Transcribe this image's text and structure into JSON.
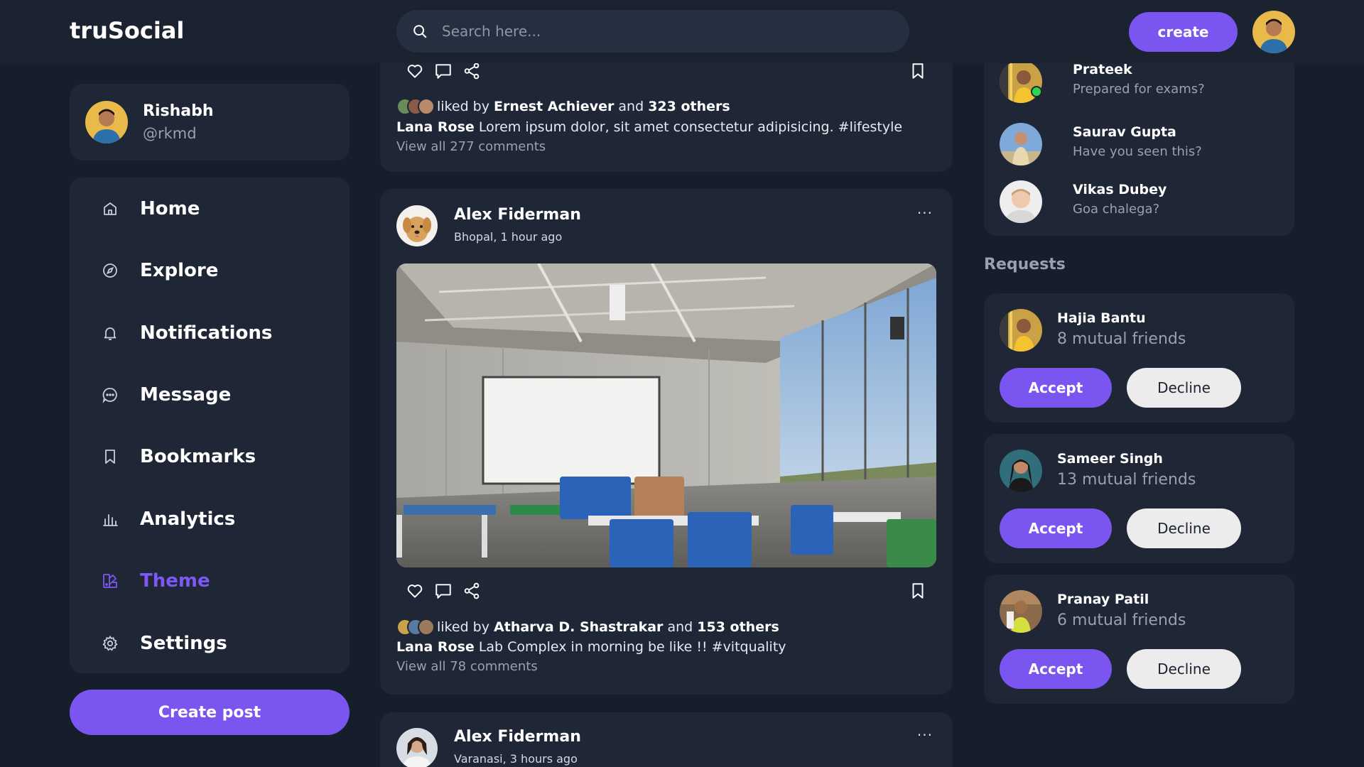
{
  "header": {
    "logo": "truSocial",
    "search_placeholder": "Search here...",
    "create_label": "create"
  },
  "profile": {
    "name": "Rishabh",
    "handle": "@rkmd"
  },
  "nav": {
    "items": [
      {
        "label": "Home",
        "icon": "home-icon"
      },
      {
        "label": "Explore",
        "icon": "compass-icon"
      },
      {
        "label": "Notifications",
        "icon": "bell-icon"
      },
      {
        "label": "Message",
        "icon": "chat-icon"
      },
      {
        "label": "Bookmarks",
        "icon": "bookmark-icon"
      },
      {
        "label": "Analytics",
        "icon": "bar-chart-icon"
      },
      {
        "label": "Theme",
        "icon": "palette-icon",
        "active": true
      },
      {
        "label": "Settings",
        "icon": "gear-icon"
      }
    ],
    "create_post_label": "Create post"
  },
  "feed": {
    "post1": {
      "liked_prefix": "liked by",
      "liked_by": "Ernest Achiever",
      "liked_and": "and",
      "liked_others": "323 others",
      "caption_user": "Lana Rose",
      "caption_text": "Lorem ipsum dolor, sit amet consectetur adipisicing. #lifestyle",
      "comments": "View all 277 comments"
    },
    "post2": {
      "author": "Alex Fiderman",
      "location_time": "Bhopal, 1 hour ago",
      "liked_prefix": "liked by",
      "liked_by": "Atharva D. Shastrakar",
      "liked_and": "and",
      "liked_others": "153 others",
      "caption_user": "Lana Rose",
      "caption_text": "Lab Complex in morning be like !! #vitquality",
      "comments": "View all 78 comments"
    },
    "post3": {
      "author": "Alex Fiderman",
      "location_time": "Varanasi, 3 hours ago"
    },
    "more_label": "···"
  },
  "messages": [
    {
      "name": "Prateek",
      "text": "Prepared for exams?",
      "online": true
    },
    {
      "name": "Saurav Gupta",
      "text": "Have you seen this?"
    },
    {
      "name": "Vikas Dubey",
      "text": "Goa chalega?"
    }
  ],
  "requests": {
    "title": "Requests",
    "accept_label": "Accept",
    "decline_label": "Decline",
    "items": [
      {
        "name": "Hajia Bantu",
        "mutual": "8 mutual friends"
      },
      {
        "name": "Sameer Singh",
        "mutual": "13 mutual friends"
      },
      {
        "name": "Pranay Patil",
        "mutual": "6 mutual friends"
      }
    ]
  },
  "colors": {
    "accent": "#7a55f0",
    "background": "#161d2b",
    "card": "#1f2636",
    "online": "#2bd552"
  }
}
